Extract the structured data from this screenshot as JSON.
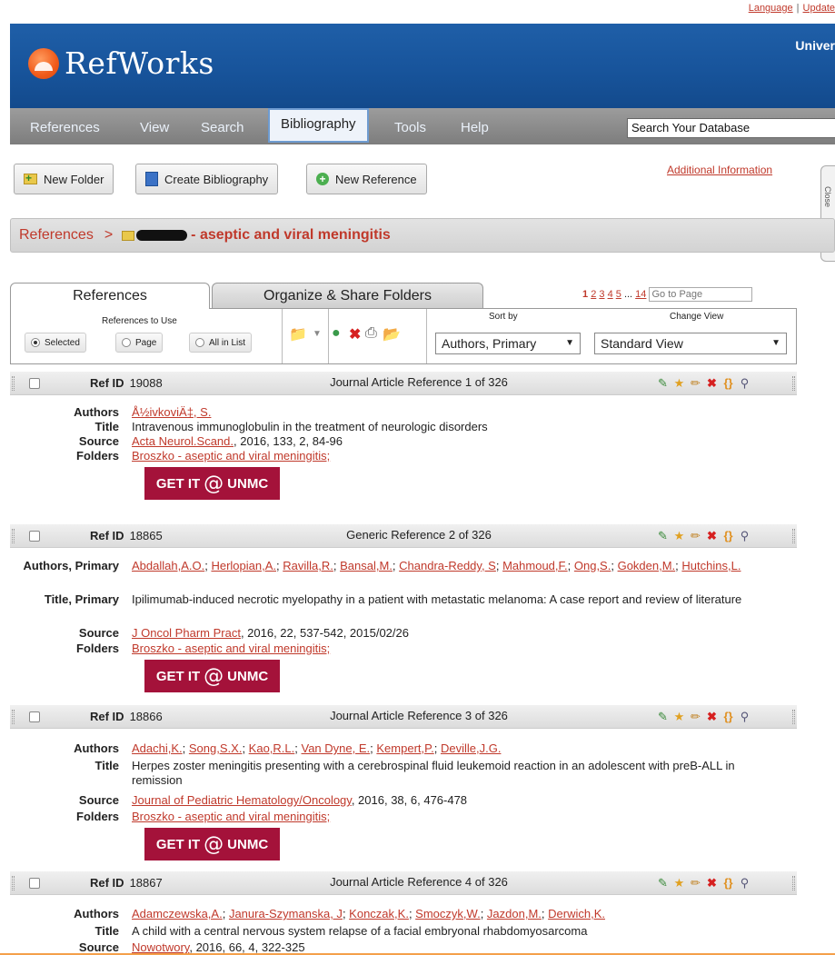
{
  "top_links": {
    "language": "Language",
    "separator": "|",
    "update": "Update"
  },
  "header": {
    "brand": "RefWorks",
    "institution": "Univer"
  },
  "nav": {
    "items": [
      "References",
      "View",
      "Search",
      "Bibliography",
      "Tools",
      "Help"
    ],
    "active": "Bibliography",
    "search_value": "Search Your Database"
  },
  "toolbar": {
    "new_folder": "New Folder",
    "create_bibliography": "Create Bibliography",
    "new_reference": "New Reference",
    "additional_info": "Additional Information"
  },
  "close_tab": "Close",
  "breadcrumb": {
    "root": "References",
    "separator": ">",
    "folder": "- aseptic and viral meningitis"
  },
  "tabs": {
    "references": "References",
    "organize": "Organize & Share Folders"
  },
  "pager": {
    "pages": [
      "1",
      "2",
      "3",
      "4",
      "5"
    ],
    "ellipsis": "...",
    "last": "14",
    "current": "1",
    "goto_placeholder": "Go to Page"
  },
  "options": {
    "refs_to_use_label": "References to Use",
    "selected": "Selected",
    "page": "Page",
    "all_in_list": "All in List",
    "sort_label": "Sort by",
    "sort_value": "Authors, Primary",
    "view_label": "Change View",
    "view_value": "Standard View"
  },
  "getit": {
    "pre": "GET IT",
    "at": "@",
    "post": "UNMC"
  },
  "references": [
    {
      "ref_id_label": "Ref ID",
      "ref_id": "19088",
      "type": "Journal Article Reference 1 of 326",
      "authors_label": "Authors",
      "authors": [
        "Å½ivkoviÄ‡, S."
      ],
      "title_label": "Title",
      "title": "Intravenous immunoglobulin in the treatment of neurologic disorders",
      "source_label": "Source",
      "source_link": "Acta Neurol.Scand.",
      "source_rest": ", 2016, 133, 2, 84-96",
      "folders_label": "Folders",
      "folders": "Broszko - aseptic and viral meningitis;"
    },
    {
      "ref_id_label": "Ref ID",
      "ref_id": "18865",
      "type": "Generic Reference 2 of 326",
      "authors_label": "Authors, Primary",
      "authors": [
        "Abdallah,A.O.",
        "Herlopian,A.",
        "Ravilla,R.",
        "Bansal,M.",
        "Chandra-Reddy, S",
        "Mahmoud,F.",
        "Ong,S.",
        "Gokden,M.",
        "Hutchins,L."
      ],
      "title_label": "Title, Primary",
      "title": "Ipilimumab-induced necrotic myelopathy in a patient with metastatic melanoma: A case report and review of literature",
      "source_label": "Source",
      "source_link": "J Oncol Pharm Pract",
      "source_rest": ", 2016, 22, 537-542, 2015/02/26",
      "folders_label": "Folders",
      "folders": "Broszko - aseptic and viral meningitis;"
    },
    {
      "ref_id_label": "Ref ID",
      "ref_id": "18866",
      "type": "Journal Article Reference 3 of 326",
      "authors_label": "Authors",
      "authors": [
        "Adachi,K.",
        "Song,S.X.",
        "Kao,R.L.",
        "Van Dyne, E.",
        "Kempert,P.",
        "Deville,J.G."
      ],
      "title_label": "Title",
      "title": "Herpes zoster meningitis presenting with a cerebrospinal fluid leukemoid reaction in an adolescent with preB-ALL in remission",
      "source_label": "Source",
      "source_link": "Journal of Pediatric Hematology/Oncology",
      "source_rest": ", 2016, 38, 6, 476-478",
      "folders_label": "Folders",
      "folders": "Broszko - aseptic and viral meningitis;"
    },
    {
      "ref_id_label": "Ref ID",
      "ref_id": "18867",
      "type": "Journal Article Reference 4 of 326",
      "authors_label": "Authors",
      "authors": [
        "Adamczewska,A.",
        "Janura-Szymanska, J",
        "Konczak,K.",
        "Smoczyk,W.",
        "Jazdon,M.",
        "Derwich,K."
      ],
      "title_label": "Title",
      "title": "A child with a central nervous system relapse of a facial embryonal rhabdomyosarcoma",
      "source_label": "Source",
      "source_link": "Nowotwory",
      "source_rest": ", 2016, 66, 4, 322-325"
    }
  ]
}
